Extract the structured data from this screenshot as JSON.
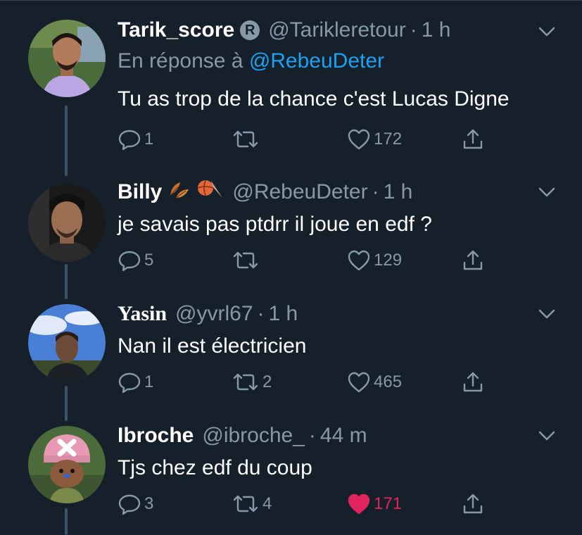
{
  "tweets": [
    {
      "name": "Tarik_score",
      "badge": "R",
      "handle": "@Tarikleretour",
      "time": "1 h",
      "reply_prefix": "En réponse à",
      "reply_mention": "@RebeuDeter",
      "text": "Tu as trop de la chance c'est Lucas Digne",
      "replies": "1",
      "retweets": "",
      "likes": "172",
      "liked": false
    },
    {
      "name": "Billy",
      "emojis": [
        "fallen-leaves-emoji",
        "basketball-emoji"
      ],
      "handle": "@RebeuDeter",
      "time": "1 h",
      "text": "je savais pas ptdrr il joue en edf ?",
      "replies": "5",
      "retweets": "",
      "likes": "129",
      "liked": false
    },
    {
      "name": "Yasin",
      "handle": "@yvrl67",
      "time": "1 h",
      "text": "Nan il est électricien",
      "replies": "1",
      "retweets": "2",
      "likes": "465",
      "liked": false
    },
    {
      "name": "Ibroche",
      "handle": "@ibroche_",
      "time": "44 m",
      "text": "Tjs chez edf du coup",
      "replies": "3",
      "retweets": "4",
      "likes": "171",
      "liked": true
    }
  ],
  "colors": {
    "background": "#15202b",
    "secondary_text": "#8899a6",
    "link": "#1da1f2",
    "like_active": "#e0245e",
    "thread_line": "#3d5466"
  }
}
